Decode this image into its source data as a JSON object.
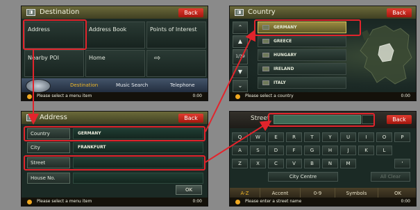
{
  "colors": {
    "annotation": "#e2242c",
    "accent": "#f0b828",
    "back_button": "#c4231a"
  },
  "destination": {
    "title": "Destination",
    "back": "Back",
    "menu": [
      "Address",
      "Address Book",
      "Points of Interest",
      "Nearby POI",
      "Home",
      "⇨"
    ],
    "tabs": [
      "Destination",
      "Music Search",
      "Telephone"
    ],
    "status": "Please select a menu item",
    "time": "0:00"
  },
  "country": {
    "title": "Country",
    "back": "Back",
    "items": [
      "GERMANY",
      "GREECE",
      "HUNGARY",
      "IRELAND",
      "ITALY"
    ],
    "selected": "GERMANY",
    "side_buttons": [
      "⌃",
      "▲",
      "1/39",
      "▼",
      "⌄"
    ],
    "status": "Please select a country",
    "time": "0:00"
  },
  "address": {
    "title": "Address",
    "back": "Back",
    "fields": [
      {
        "label": "Country",
        "value": "GERMANY"
      },
      {
        "label": "City",
        "value": "FRANKFURT"
      },
      {
        "label": "Street",
        "value": ""
      },
      {
        "label": "House No.",
        "value": ""
      }
    ],
    "ok": "OK",
    "status": "Please select a menu item",
    "time": "0:00"
  },
  "street": {
    "label": "Street",
    "back": "Back",
    "rows": [
      [
        "Q",
        "W",
        "E",
        "R",
        "T",
        "Y",
        "U",
        "I",
        "O",
        "P"
      ],
      [
        "A",
        "S",
        "D",
        "F",
        "G",
        "H",
        "J",
        "K",
        "L"
      ],
      [
        "Z",
        "X",
        "C",
        "V",
        "B",
        "N",
        "M",
        "'"
      ]
    ],
    "suggestion": "City Centre",
    "all_clear": "All Clear",
    "bottom": [
      "A-Z",
      "Accent",
      "0-9",
      "Symbols",
      "OK"
    ],
    "status": "Please enter a street name",
    "time": "0:00"
  }
}
